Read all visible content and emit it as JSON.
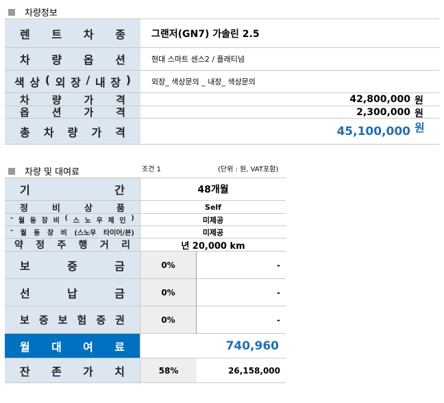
{
  "section1": {
    "title": "차량정보",
    "rows": [
      {
        "label": [
          "렌",
          "트",
          "차",
          "종"
        ],
        "value": "그랜저(GN7) 가솔린 2.5"
      },
      {
        "label": [
          "차",
          "량",
          "옵",
          "션"
        ],
        "value": "현대 스마트 센스2 / 플래티넘"
      },
      {
        "label": [
          "색",
          "상",
          "(",
          "외",
          "장",
          "/",
          "내",
          "장",
          ")"
        ],
        "value": "외장_ 색상문의 _ 내장_ 색상문의"
      },
      {
        "label": [
          "차",
          "량",
          "가",
          "격"
        ],
        "value": "42,800,000",
        "unit": "원"
      },
      {
        "label": [
          "옵",
          "션",
          "가",
          "격"
        ],
        "value": "2,300,000",
        "unit": "원"
      },
      {
        "label": [
          "총",
          "차",
          "량",
          "가",
          "격"
        ],
        "value": "45,100,000",
        "unit": "원"
      }
    ]
  },
  "section2": {
    "title": "차량 및 대여료",
    "condition": "조건 1",
    "unit_note": "(단위 : 원, VAT포함)",
    "rows": [
      {
        "label": [
          "기",
          "간"
        ],
        "value": "48개월"
      },
      {
        "label": [
          "정",
          "비",
          "상",
          "품"
        ],
        "value": "Self"
      },
      {
        "label": [
          "-",
          "월",
          "동",
          "장",
          "비",
          "(",
          "스",
          "노",
          "우",
          "체",
          "인",
          ")"
        ],
        "value": "미제공"
      },
      {
        "label": [
          "-",
          "월",
          "동",
          "장",
          "비",
          "(스노우",
          "타이어/본)"
        ],
        "value": "미제공"
      },
      {
        "label": [
          "약",
          "정",
          "주",
          "행",
          "거",
          "리"
        ],
        "value": "년 20,000 km"
      },
      {
        "label": [
          "보",
          "증",
          "금"
        ],
        "pct": "0%",
        "amount": "-"
      },
      {
        "label": [
          "선",
          "납",
          "금"
        ],
        "pct": "0%",
        "amount": "-"
      },
      {
        "label": [
          "보",
          "증",
          "보",
          "험",
          "증",
          "권"
        ],
        "pct": "0%",
        "amount": "-"
      },
      {
        "label": [
          "월",
          "대",
          "여",
          "료"
        ],
        "value": "740,960"
      },
      {
        "label": [
          "잔",
          "존",
          "가",
          "치"
        ],
        "pct": "58%",
        "amount": "26,158,000"
      }
    ]
  },
  "colors": {
    "label_bg": "#dce6f1",
    "highlight_blue": "#0070c0",
    "total_blue": "#1f6eb5"
  }
}
